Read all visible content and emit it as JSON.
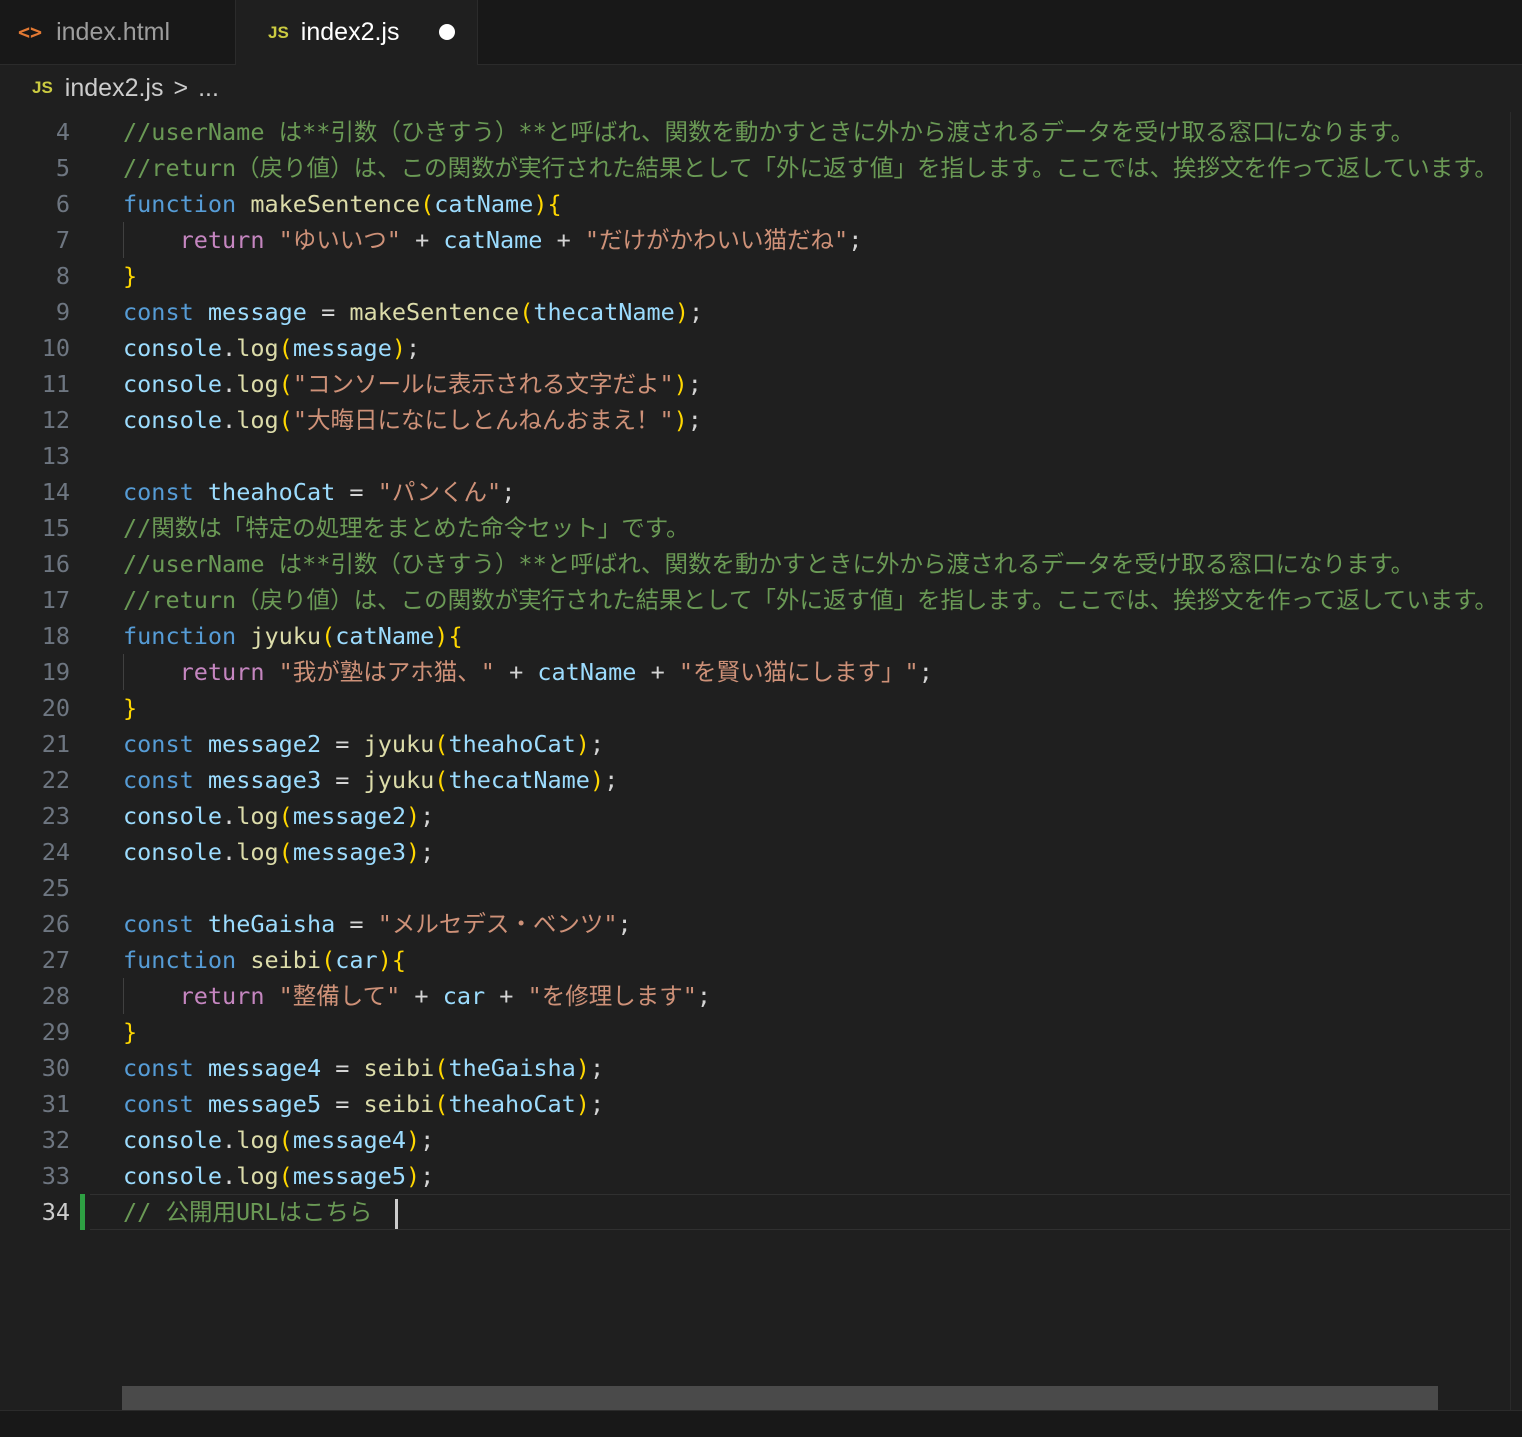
{
  "tabs": [
    {
      "label": "index.html",
      "icon": "html-file-icon",
      "active": false
    },
    {
      "label": "index2.js",
      "icon": "js-file-icon",
      "active": true,
      "modified": true
    }
  ],
  "breadcrumb": {
    "file": "index2.js",
    "separator": ">",
    "rest": "..."
  },
  "editor": {
    "current_line": 34,
    "lines": [
      {
        "n": "4",
        "tokens": [
          [
            "cm",
            "//userName は**引数（ひきすう）**と呼ばれ、関数を動かすときに外から渡されるデータを受け取る窓口になります。"
          ]
        ]
      },
      {
        "n": "5",
        "tokens": [
          [
            "cm",
            "//return（戻り値）は、この関数が実行された結果として「外に返す値」を指します。ここでは、挨拶文を作って返しています。"
          ]
        ]
      },
      {
        "n": "6",
        "tokens": [
          [
            "kw",
            "function"
          ],
          [
            "op",
            " "
          ],
          [
            "fn",
            "makeSentence"
          ],
          [
            "p1",
            "("
          ],
          [
            "var",
            "catName"
          ],
          [
            "p1",
            ")"
          ],
          [
            "p1",
            "{"
          ]
        ]
      },
      {
        "n": "7",
        "guide": true,
        "tokens": [
          [
            "op",
            "    "
          ],
          [
            "ctl",
            "return"
          ],
          [
            "op",
            " "
          ],
          [
            "str",
            "\"ゆいいつ\""
          ],
          [
            "op",
            " + "
          ],
          [
            "var",
            "catName"
          ],
          [
            "op",
            " + "
          ],
          [
            "str",
            "\"だけがかわいい猫だね\""
          ],
          [
            "op",
            ";"
          ]
        ]
      },
      {
        "n": "8",
        "tokens": [
          [
            "p1",
            "}"
          ]
        ]
      },
      {
        "n": "9",
        "tokens": [
          [
            "kw",
            "const"
          ],
          [
            "op",
            " "
          ],
          [
            "var",
            "message"
          ],
          [
            "op",
            " = "
          ],
          [
            "fn",
            "makeSentence"
          ],
          [
            "p1",
            "("
          ],
          [
            "var",
            "thecatName"
          ],
          [
            "p1",
            ")"
          ],
          [
            "op",
            ";"
          ]
        ]
      },
      {
        "n": "10",
        "tokens": [
          [
            "var",
            "console"
          ],
          [
            "op",
            "."
          ],
          [
            "fn",
            "log"
          ],
          [
            "p1",
            "("
          ],
          [
            "var",
            "message"
          ],
          [
            "p1",
            ")"
          ],
          [
            "op",
            ";"
          ]
        ]
      },
      {
        "n": "11",
        "tokens": [
          [
            "var",
            "console"
          ],
          [
            "op",
            "."
          ],
          [
            "fn",
            "log"
          ],
          [
            "p1",
            "("
          ],
          [
            "str",
            "\"コンソールに表示される文字だよ\""
          ],
          [
            "p1",
            ")"
          ],
          [
            "op",
            ";"
          ]
        ]
      },
      {
        "n": "12",
        "tokens": [
          [
            "var",
            "console"
          ],
          [
            "op",
            "."
          ],
          [
            "fn",
            "log"
          ],
          [
            "p1",
            "("
          ],
          [
            "str",
            "\"大晦日になにしとんねんおまえ！\""
          ],
          [
            "p1",
            ")"
          ],
          [
            "op",
            ";"
          ]
        ]
      },
      {
        "n": "13",
        "tokens": []
      },
      {
        "n": "14",
        "tokens": [
          [
            "kw",
            "const"
          ],
          [
            "op",
            " "
          ],
          [
            "var",
            "theahoCat"
          ],
          [
            "op",
            " = "
          ],
          [
            "str",
            "\"パンくん\""
          ],
          [
            "op",
            ";"
          ]
        ]
      },
      {
        "n": "15",
        "tokens": [
          [
            "cm",
            "//関数は「特定の処理をまとめた命令セット」です。"
          ]
        ]
      },
      {
        "n": "16",
        "tokens": [
          [
            "cm",
            "//userName は**引数（ひきすう）**と呼ばれ、関数を動かすときに外から渡されるデータを受け取る窓口になります。"
          ]
        ]
      },
      {
        "n": "17",
        "tokens": [
          [
            "cm",
            "//return（戻り値）は、この関数が実行された結果として「外に返す値」を指します。ここでは、挨拶文を作って返しています。"
          ]
        ]
      },
      {
        "n": "18",
        "tokens": [
          [
            "kw",
            "function"
          ],
          [
            "op",
            " "
          ],
          [
            "fn",
            "jyuku"
          ],
          [
            "p1",
            "("
          ],
          [
            "var",
            "catName"
          ],
          [
            "p1",
            ")"
          ],
          [
            "p1",
            "{"
          ]
        ]
      },
      {
        "n": "19",
        "guide": true,
        "tokens": [
          [
            "op",
            "    "
          ],
          [
            "ctl",
            "return"
          ],
          [
            "op",
            " "
          ],
          [
            "str",
            "\"我が塾はアホ猫、\""
          ],
          [
            "op",
            " + "
          ],
          [
            "var",
            "catName"
          ],
          [
            "op",
            " + "
          ],
          [
            "str",
            "\"を賢い猫にします」\""
          ],
          [
            "op",
            ";"
          ]
        ]
      },
      {
        "n": "20",
        "tokens": [
          [
            "p1",
            "}"
          ]
        ]
      },
      {
        "n": "21",
        "tokens": [
          [
            "kw",
            "const"
          ],
          [
            "op",
            " "
          ],
          [
            "var",
            "message2"
          ],
          [
            "op",
            " = "
          ],
          [
            "fn",
            "jyuku"
          ],
          [
            "p1",
            "("
          ],
          [
            "var",
            "theahoCat"
          ],
          [
            "p1",
            ")"
          ],
          [
            "op",
            ";"
          ]
        ]
      },
      {
        "n": "22",
        "tokens": [
          [
            "kw",
            "const"
          ],
          [
            "op",
            " "
          ],
          [
            "var",
            "message3"
          ],
          [
            "op",
            " = "
          ],
          [
            "fn",
            "jyuku"
          ],
          [
            "p1",
            "("
          ],
          [
            "var",
            "thecatName"
          ],
          [
            "p1",
            ")"
          ],
          [
            "op",
            ";"
          ]
        ]
      },
      {
        "n": "23",
        "tokens": [
          [
            "var",
            "console"
          ],
          [
            "op",
            "."
          ],
          [
            "fn",
            "log"
          ],
          [
            "p1",
            "("
          ],
          [
            "var",
            "message2"
          ],
          [
            "p1",
            ")"
          ],
          [
            "op",
            ";"
          ]
        ]
      },
      {
        "n": "24",
        "tokens": [
          [
            "var",
            "console"
          ],
          [
            "op",
            "."
          ],
          [
            "fn",
            "log"
          ],
          [
            "p1",
            "("
          ],
          [
            "var",
            "message3"
          ],
          [
            "p1",
            ")"
          ],
          [
            "op",
            ";"
          ]
        ]
      },
      {
        "n": "25",
        "tokens": []
      },
      {
        "n": "26",
        "tokens": [
          [
            "kw",
            "const"
          ],
          [
            "op",
            " "
          ],
          [
            "var",
            "theGaisha"
          ],
          [
            "op",
            " = "
          ],
          [
            "str",
            "\"メルセデス・ベンツ\""
          ],
          [
            "op",
            ";"
          ]
        ]
      },
      {
        "n": "27",
        "tokens": [
          [
            "kw",
            "function"
          ],
          [
            "op",
            " "
          ],
          [
            "fn",
            "seibi"
          ],
          [
            "p1",
            "("
          ],
          [
            "var",
            "car"
          ],
          [
            "p1",
            ")"
          ],
          [
            "p1",
            "{"
          ]
        ]
      },
      {
        "n": "28",
        "guide": true,
        "tokens": [
          [
            "op",
            "    "
          ],
          [
            "ctl",
            "return"
          ],
          [
            "op",
            " "
          ],
          [
            "str",
            "\"整備して\""
          ],
          [
            "op",
            " + "
          ],
          [
            "var",
            "car"
          ],
          [
            "op",
            " + "
          ],
          [
            "str",
            "\"を修理します\""
          ],
          [
            "op",
            ";"
          ]
        ]
      },
      {
        "n": "29",
        "tokens": [
          [
            "p1",
            "}"
          ]
        ]
      },
      {
        "n": "30",
        "tokens": [
          [
            "kw",
            "const"
          ],
          [
            "op",
            " "
          ],
          [
            "var",
            "message4"
          ],
          [
            "op",
            " = "
          ],
          [
            "fn",
            "seibi"
          ],
          [
            "p1",
            "("
          ],
          [
            "var",
            "theGaisha"
          ],
          [
            "p1",
            ")"
          ],
          [
            "op",
            ";"
          ]
        ]
      },
      {
        "n": "31",
        "tokens": [
          [
            "kw",
            "const"
          ],
          [
            "op",
            " "
          ],
          [
            "var",
            "message5"
          ],
          [
            "op",
            " = "
          ],
          [
            "fn",
            "seibi"
          ],
          [
            "p1",
            "("
          ],
          [
            "var",
            "theahoCat"
          ],
          [
            "p1",
            ")"
          ],
          [
            "op",
            ";"
          ]
        ]
      },
      {
        "n": "32",
        "tokens": [
          [
            "var",
            "console"
          ],
          [
            "op",
            "."
          ],
          [
            "fn",
            "log"
          ],
          [
            "p1",
            "("
          ],
          [
            "var",
            "message4"
          ],
          [
            "p1",
            ")"
          ],
          [
            "op",
            ";"
          ]
        ]
      },
      {
        "n": "33",
        "tokens": [
          [
            "var",
            "console"
          ],
          [
            "op",
            "."
          ],
          [
            "fn",
            "log"
          ],
          [
            "p1",
            "("
          ],
          [
            "var",
            "message5"
          ],
          [
            "p1",
            ")"
          ],
          [
            "op",
            ";"
          ]
        ]
      },
      {
        "n": "34",
        "tokens": [
          [
            "cm",
            "// 公開用URLはこちら "
          ]
        ]
      }
    ]
  }
}
